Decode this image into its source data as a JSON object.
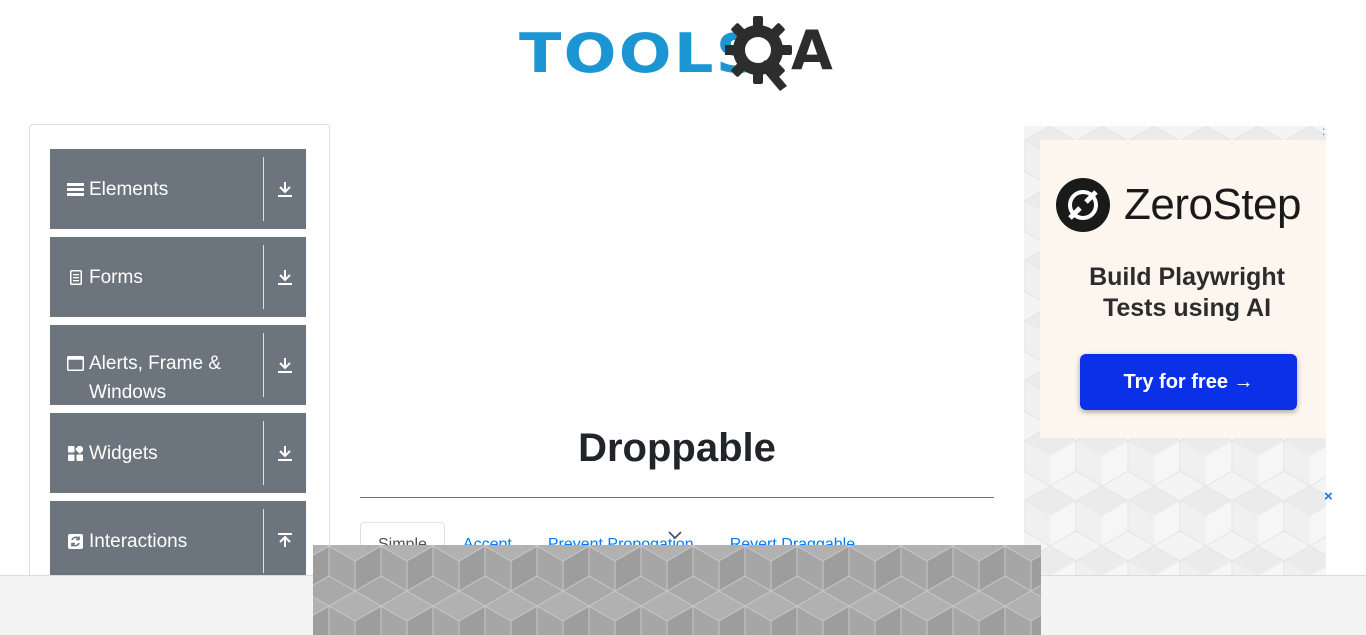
{
  "header": {
    "logo_text_primary": "TOOLS",
    "logo_text_secondary": "A",
    "logo_icon": "gear-q-icon"
  },
  "sidebar": {
    "groups": [
      {
        "label": "Elements",
        "icon": "bars-icon",
        "toggle_icon": "download-arrow-icon"
      },
      {
        "label": "Forms",
        "icon": "document-icon",
        "toggle_icon": "download-arrow-icon"
      },
      {
        "label": "Alerts, Frame & Windows",
        "icon": "window-icon",
        "toggle_icon": "download-arrow-icon"
      },
      {
        "label": "Widgets",
        "icon": "grid-icon",
        "toggle_icon": "download-arrow-icon"
      },
      {
        "label": "Interactions",
        "icon": "interaction-icon",
        "toggle_icon": "upload-arrow-icon"
      }
    ]
  },
  "main": {
    "title": "Droppable",
    "tabs": [
      {
        "label": "Simple",
        "active": true
      },
      {
        "label": "Accept",
        "active": false
      },
      {
        "label": "Prevent Propogation",
        "active": false
      },
      {
        "label": "Revert Draggable",
        "active": false
      }
    ]
  },
  "ad": {
    "brand": "ZeroStep",
    "headline_line1": "Build Playwright",
    "headline_line2": "Tests using AI",
    "cta": "Try for free →",
    "info_label": ":",
    "close_label": "×"
  },
  "colors": {
    "brand_blue": "#1b96d2",
    "sidebar_group_bg": "#6c757d",
    "tab_link": "#007bff",
    "ad_cta": "#0a30e8"
  }
}
